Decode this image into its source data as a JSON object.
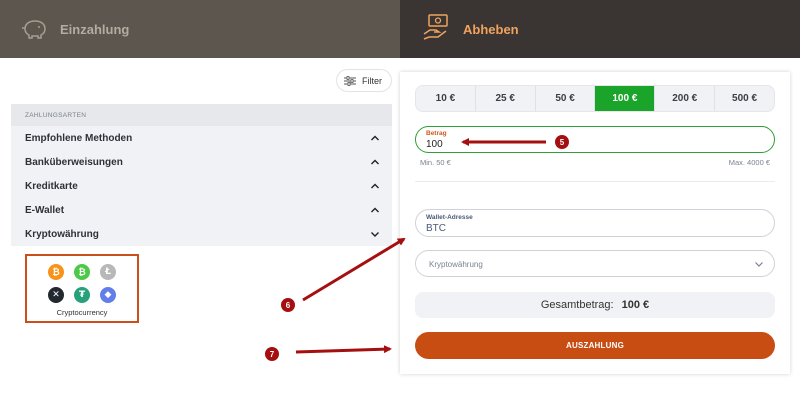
{
  "header": {
    "deposit_label": "Einzahlung",
    "withdraw_label": "Abheben"
  },
  "filter": {
    "label": "Filter"
  },
  "methods": {
    "section_title": "ZAHLUNGSARTEN",
    "items": [
      {
        "label": "Empfohlene Methoden",
        "state": "expanded"
      },
      {
        "label": "Banküberweisungen",
        "state": "expanded"
      },
      {
        "label": "Kreditkarte",
        "state": "expanded"
      },
      {
        "label": "E-Wallet",
        "state": "expanded"
      },
      {
        "label": "Kryptowährung",
        "state": "collapsed"
      }
    ]
  },
  "crypto_card": {
    "label": "Cryptocurrency",
    "coins": [
      {
        "name": "bitcoin-icon",
        "color": "#f7931a"
      },
      {
        "name": "bitcoin-cash-icon",
        "color": "#4cc947"
      },
      {
        "name": "litecoin-icon",
        "color": "#b8b8b8"
      },
      {
        "name": "xrp-icon",
        "color": "#23292f"
      },
      {
        "name": "tether-icon",
        "color": "#26a17b"
      },
      {
        "name": "ethereum-icon",
        "color": "#627eea"
      }
    ]
  },
  "amounts": {
    "options": [
      "10 €",
      "25 €",
      "50 €",
      "100 €",
      "200 €",
      "500 €"
    ],
    "selected": "100 €"
  },
  "betrag": {
    "label": "Betrag",
    "value": "100",
    "min": "Min. 50 €",
    "max": "Max. 4000 €"
  },
  "wallet": {
    "label": "Wallet-Adresse",
    "value": "BTC"
  },
  "crypto_select": {
    "placeholder": "Kryptowährung"
  },
  "total": {
    "label": "Gesamtbetrag:",
    "value": "100 €"
  },
  "payout_button": {
    "label": "AUSZAHLUNG"
  },
  "annotations": [
    "5",
    "6",
    "7"
  ],
  "colors": {
    "accent_green": "#1aa52a",
    "accent_orange": "#c84d13",
    "header_dark": "#3a3432",
    "annotation_red": "#a50f0f"
  }
}
